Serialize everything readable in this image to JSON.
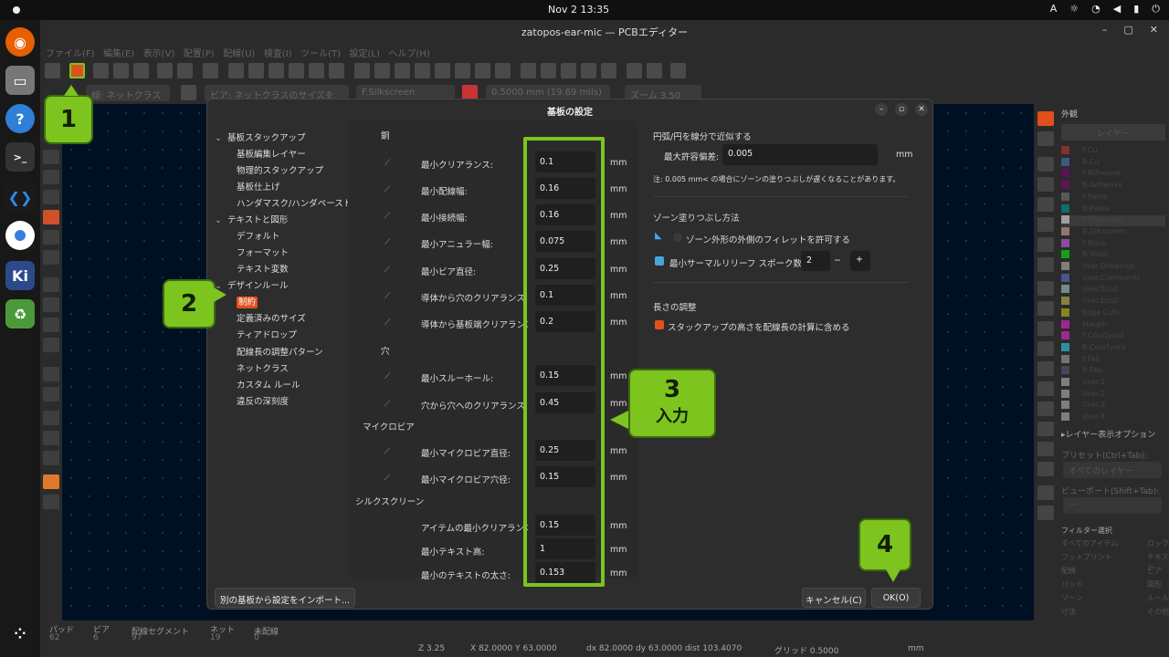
{
  "system": {
    "clock": "Nov 2  13:35",
    "lang": "A"
  },
  "window": {
    "title": "zatopos-ear-mic — PCBエディター"
  },
  "menubar": [
    "ファイル(F)",
    "編集(E)",
    "表示(V)",
    "配置(P)",
    "配線(U)",
    "検査(I)",
    "ツール(T)",
    "設定(L)",
    "ヘルプ(H)"
  ],
  "toolbar2": {
    "track_combo": "線: ネットクラスの幅を使用",
    "via_combo": "ビア: ネットクラスのサイズを使用",
    "layer_combo": "F.Silkscreen",
    "grid_combo": "0.5000 mm (19.69 mils)",
    "zoom_combo": "ズーム 3.50"
  },
  "dialog": {
    "title": "基板の設定",
    "tree": [
      {
        "label": "基板スタックアップ",
        "type": "node"
      },
      {
        "label": "基板編集レイヤー",
        "type": "leaf"
      },
      {
        "label": "物理的スタックアップ",
        "type": "leaf"
      },
      {
        "label": "基板仕上げ",
        "type": "leaf"
      },
      {
        "label": "ハンダマスク/ハンダペースト",
        "type": "leaf"
      },
      {
        "label": "テキストと図形",
        "type": "node"
      },
      {
        "label": "デフォルト",
        "type": "leaf"
      },
      {
        "label": "フォーマット",
        "type": "leaf"
      },
      {
        "label": "テキスト変数",
        "type": "leaf"
      },
      {
        "label": "デザインルール",
        "type": "node"
      },
      {
        "label": "制約",
        "type": "leaf",
        "selected": true
      },
      {
        "label": "定義済みのサイズ",
        "type": "leaf"
      },
      {
        "label": "ティアドロップ",
        "type": "leaf"
      },
      {
        "label": "配線長の調整パターン",
        "type": "leaf"
      },
      {
        "label": "ネットクラス",
        "type": "leaf"
      },
      {
        "label": "カスタム ルール",
        "type": "leaf"
      },
      {
        "label": "違反の深刻度",
        "type": "leaf"
      }
    ],
    "sections": {
      "copper": "銅",
      "holes": "穴",
      "microvia": "マイクロビア",
      "silkscreen": "シルクスクリーン"
    },
    "unit": "mm",
    "fields": [
      {
        "label": "最小クリアランス:",
        "value": "0.1",
        "icon": "clearance-icon"
      },
      {
        "label": "最小配線幅:",
        "value": "0.16",
        "icon": "track-width-icon"
      },
      {
        "label": "最小接続幅:",
        "value": "0.16",
        "icon": "connection-width-icon"
      },
      {
        "label": "最小アニュラー幅:",
        "value": "0.075",
        "icon": "annular-icon"
      },
      {
        "label": "最小ビア直径:",
        "value": "0.25",
        "icon": "via-diameter-icon"
      },
      {
        "label": "導体から穴のクリアランス:",
        "value": "0.1",
        "icon": "copper-hole-icon"
      },
      {
        "label": "導体から基板端クリアランス:",
        "value": "0.2",
        "icon": "edge-clearance-icon"
      },
      {
        "label": "最小スルーホール:",
        "value": "0.15",
        "icon": "through-hole-icon"
      },
      {
        "label": "穴から穴へのクリアランス:",
        "value": "0.45",
        "icon": "hole-hole-icon"
      },
      {
        "label": "最小マイクロビア直径:",
        "value": "0.25",
        "icon": "microvia-diameter-icon"
      },
      {
        "label": "最小マイクロビア穴径:",
        "value": "0.15",
        "icon": "microvia-hole-icon"
      },
      {
        "label": "アイテムの最小クリアランス:",
        "value": "0.15",
        "icon": ""
      },
      {
        "label": "最小テキスト高:",
        "value": "1",
        "icon": ""
      },
      {
        "label": "最小のテキストの太さ:",
        "value": "0.153",
        "icon": ""
      }
    ],
    "right": {
      "arc_title": "円弧/円を線分で近似する",
      "max_dev_label": "最大許容偏差:",
      "max_dev_value": "0.005",
      "max_dev_unit": "mm",
      "note": "注: 0.005 mm< の場合にゾーンの塗りつぶしが遅くなることがあります。",
      "zone_title": "ゾーン塗りつぶし方法",
      "zone_fillet_label": "ゾーン外形の外側のフィレットを許可する",
      "thermal_label": "最小サーマルリリーフ スポーク数:",
      "thermal_value": "2",
      "minus": "−",
      "plus": "+",
      "length_title": "長さの調整",
      "length_check_label": "スタックアップの高さを配線長の計算に含める"
    },
    "buttons": {
      "import": "別の基板から設定をインポート...",
      "cancel": "キャンセル(C)",
      "ok": "OK(O)"
    }
  },
  "callouts": {
    "c1": "1",
    "c2": "2",
    "c3_num": "3",
    "c3_text": "入力",
    "c4": "4"
  },
  "rightpanel": {
    "header": "外観",
    "tab": "レイヤー",
    "layers": [
      "F.Cu",
      "B.Cu",
      "F.Adhesive",
      "B.Adhesive",
      "F.Paste",
      "B.Paste",
      "F.Silkscreen",
      "B.Silkscreen",
      "F.Mask",
      "B.Mask",
      "User.Drawings",
      "User.Comments",
      "User.Eco1",
      "User.Eco2",
      "Edge.Cuts",
      "Margin",
      "F.Courtyard",
      "B.Courtyard",
      "F.Fab",
      "B.Fab",
      "User.1",
      "User.2",
      "User.3",
      "User.4"
    ],
    "layer_colors": [
      "#c83434",
      "#4d7fc4",
      "#84007e",
      "#8a0084",
      "#808080",
      "#00a0a0",
      "#f0f0f0",
      "#e8b2a7",
      "#d864ff",
      "#01ff01",
      "#c2c2c2",
      "#5a7fd9",
      "#b4dbd2",
      "#d8c852",
      "#d0d210",
      "#ff26e2",
      "#ff26e2",
      "#26e9ff",
      "#afafaf",
      "#585d84",
      "#c2c2c2",
      "#c2c2c2",
      "#c2c2c2",
      "#c2c2c2"
    ],
    "layer_options": "▸レイヤー表示オプション",
    "preset_label": "プリセット(Ctrl+Tab):",
    "preset_value": "すべてのレイヤー",
    "viewport_label": "ビューポート(Shift+Tab):",
    "viewport_value": "---",
    "filter_title": "フィルター選択",
    "filters_left": [
      "すべてのアイテム",
      "フットプリント",
      "配線",
      "パッド",
      "ゾーン",
      "寸法"
    ],
    "filters_right": [
      "ロック",
      "テキスト",
      "ビア",
      "図形",
      "ルール",
      "その他"
    ]
  },
  "status": {
    "pads_label": "パッド",
    "pads": "62",
    "vias_label": "ビア",
    "vias": "6",
    "segs_label": "配線セグメント",
    "segs": "97",
    "nets_label": "ネット",
    "nets": "19",
    "unrouted_label": "未配線",
    "unrouted": "0",
    "zoom": "Z 3.25",
    "xy": "X 82.0000  Y 63.0000",
    "dxy": "dx 82.0000  dy 63.0000  dist 103.4070",
    "grid": "グリッド 0.5000",
    "units": "mm"
  },
  "colors": {
    "accent_green": "#7dc41f",
    "selection_orange": "#e0501f",
    "canvas": "#001023"
  }
}
